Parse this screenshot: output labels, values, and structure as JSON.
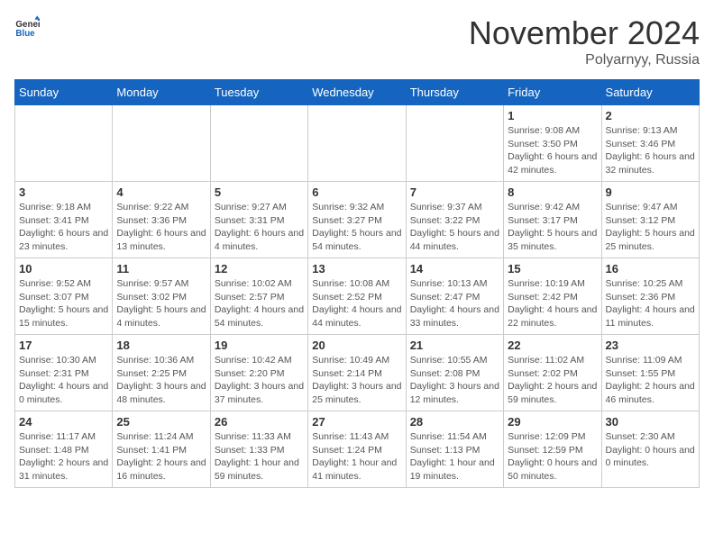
{
  "header": {
    "logo_general": "General",
    "logo_blue": "Blue",
    "month_title": "November 2024",
    "location": "Polyarnyy, Russia"
  },
  "weekdays": [
    "Sunday",
    "Monday",
    "Tuesday",
    "Wednesday",
    "Thursday",
    "Friday",
    "Saturday"
  ],
  "weeks": [
    [
      {
        "day": "",
        "info": ""
      },
      {
        "day": "",
        "info": ""
      },
      {
        "day": "",
        "info": ""
      },
      {
        "day": "",
        "info": ""
      },
      {
        "day": "",
        "info": ""
      },
      {
        "day": "1",
        "info": "Sunrise: 9:08 AM\nSunset: 3:50 PM\nDaylight: 6 hours and 42 minutes."
      },
      {
        "day": "2",
        "info": "Sunrise: 9:13 AM\nSunset: 3:46 PM\nDaylight: 6 hours and 32 minutes."
      }
    ],
    [
      {
        "day": "3",
        "info": "Sunrise: 9:18 AM\nSunset: 3:41 PM\nDaylight: 6 hours and 23 minutes."
      },
      {
        "day": "4",
        "info": "Sunrise: 9:22 AM\nSunset: 3:36 PM\nDaylight: 6 hours and 13 minutes."
      },
      {
        "day": "5",
        "info": "Sunrise: 9:27 AM\nSunset: 3:31 PM\nDaylight: 6 hours and 4 minutes."
      },
      {
        "day": "6",
        "info": "Sunrise: 9:32 AM\nSunset: 3:27 PM\nDaylight: 5 hours and 54 minutes."
      },
      {
        "day": "7",
        "info": "Sunrise: 9:37 AM\nSunset: 3:22 PM\nDaylight: 5 hours and 44 minutes."
      },
      {
        "day": "8",
        "info": "Sunrise: 9:42 AM\nSunset: 3:17 PM\nDaylight: 5 hours and 35 minutes."
      },
      {
        "day": "9",
        "info": "Sunrise: 9:47 AM\nSunset: 3:12 PM\nDaylight: 5 hours and 25 minutes."
      }
    ],
    [
      {
        "day": "10",
        "info": "Sunrise: 9:52 AM\nSunset: 3:07 PM\nDaylight: 5 hours and 15 minutes."
      },
      {
        "day": "11",
        "info": "Sunrise: 9:57 AM\nSunset: 3:02 PM\nDaylight: 5 hours and 4 minutes."
      },
      {
        "day": "12",
        "info": "Sunrise: 10:02 AM\nSunset: 2:57 PM\nDaylight: 4 hours and 54 minutes."
      },
      {
        "day": "13",
        "info": "Sunrise: 10:08 AM\nSunset: 2:52 PM\nDaylight: 4 hours and 44 minutes."
      },
      {
        "day": "14",
        "info": "Sunrise: 10:13 AM\nSunset: 2:47 PM\nDaylight: 4 hours and 33 minutes."
      },
      {
        "day": "15",
        "info": "Sunrise: 10:19 AM\nSunset: 2:42 PM\nDaylight: 4 hours and 22 minutes."
      },
      {
        "day": "16",
        "info": "Sunrise: 10:25 AM\nSunset: 2:36 PM\nDaylight: 4 hours and 11 minutes."
      }
    ],
    [
      {
        "day": "17",
        "info": "Sunrise: 10:30 AM\nSunset: 2:31 PM\nDaylight: 4 hours and 0 minutes."
      },
      {
        "day": "18",
        "info": "Sunrise: 10:36 AM\nSunset: 2:25 PM\nDaylight: 3 hours and 48 minutes."
      },
      {
        "day": "19",
        "info": "Sunrise: 10:42 AM\nSunset: 2:20 PM\nDaylight: 3 hours and 37 minutes."
      },
      {
        "day": "20",
        "info": "Sunrise: 10:49 AM\nSunset: 2:14 PM\nDaylight: 3 hours and 25 minutes."
      },
      {
        "day": "21",
        "info": "Sunrise: 10:55 AM\nSunset: 2:08 PM\nDaylight: 3 hours and 12 minutes."
      },
      {
        "day": "22",
        "info": "Sunrise: 11:02 AM\nSunset: 2:02 PM\nDaylight: 2 hours and 59 minutes."
      },
      {
        "day": "23",
        "info": "Sunrise: 11:09 AM\nSunset: 1:55 PM\nDaylight: 2 hours and 46 minutes."
      }
    ],
    [
      {
        "day": "24",
        "info": "Sunrise: 11:17 AM\nSunset: 1:48 PM\nDaylight: 2 hours and 31 minutes."
      },
      {
        "day": "25",
        "info": "Sunrise: 11:24 AM\nSunset: 1:41 PM\nDaylight: 2 hours and 16 minutes."
      },
      {
        "day": "26",
        "info": "Sunrise: 11:33 AM\nSunset: 1:33 PM\nDaylight: 1 hour and 59 minutes."
      },
      {
        "day": "27",
        "info": "Sunrise: 11:43 AM\nSunset: 1:24 PM\nDaylight: 1 hour and 41 minutes."
      },
      {
        "day": "28",
        "info": "Sunrise: 11:54 AM\nSunset: 1:13 PM\nDaylight: 1 hour and 19 minutes."
      },
      {
        "day": "29",
        "info": "Sunrise: 12:09 PM\nSunset: 12:59 PM\nDaylight: 0 hours and 50 minutes."
      },
      {
        "day": "30",
        "info": "Sunset: 2:30 AM\nDaylight: 0 hours and 0 minutes."
      }
    ]
  ]
}
